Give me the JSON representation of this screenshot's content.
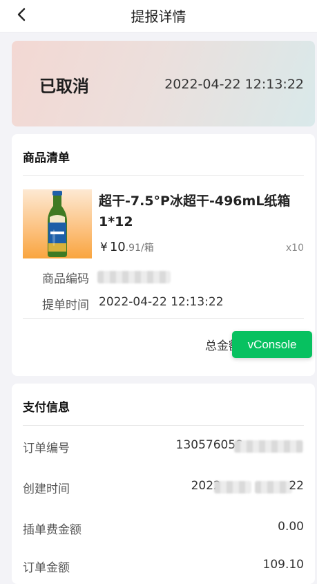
{
  "header": {
    "title": "提报详情"
  },
  "status": {
    "text": "已取消",
    "time": "2022-04-22 12:13:22"
  },
  "goods": {
    "section_title": "商品清单",
    "product": {
      "name": "超干-7.5°P冰超干-496mL纸箱1*12",
      "currency": "¥",
      "price_int": "10",
      "price_dec": ".91",
      "unit": "/箱",
      "qty": "x10"
    },
    "code_label": "商品编码",
    "submit_time_label": "提单时间",
    "submit_time": "2022-04-22 12:13:22",
    "total_label": "总金额"
  },
  "vconsole": {
    "label": "vConsole",
    "color": "#07c160"
  },
  "payment": {
    "section_title": "支付信息",
    "rows": [
      {
        "label": "订单编号",
        "value": "130576058"
      },
      {
        "label": "创建时间",
        "value_prefix": "2022-",
        "value_suffix": "22"
      },
      {
        "label": "插单费金额",
        "value": "0.00"
      },
      {
        "label": "订单金额",
        "value": "109.10"
      }
    ]
  }
}
